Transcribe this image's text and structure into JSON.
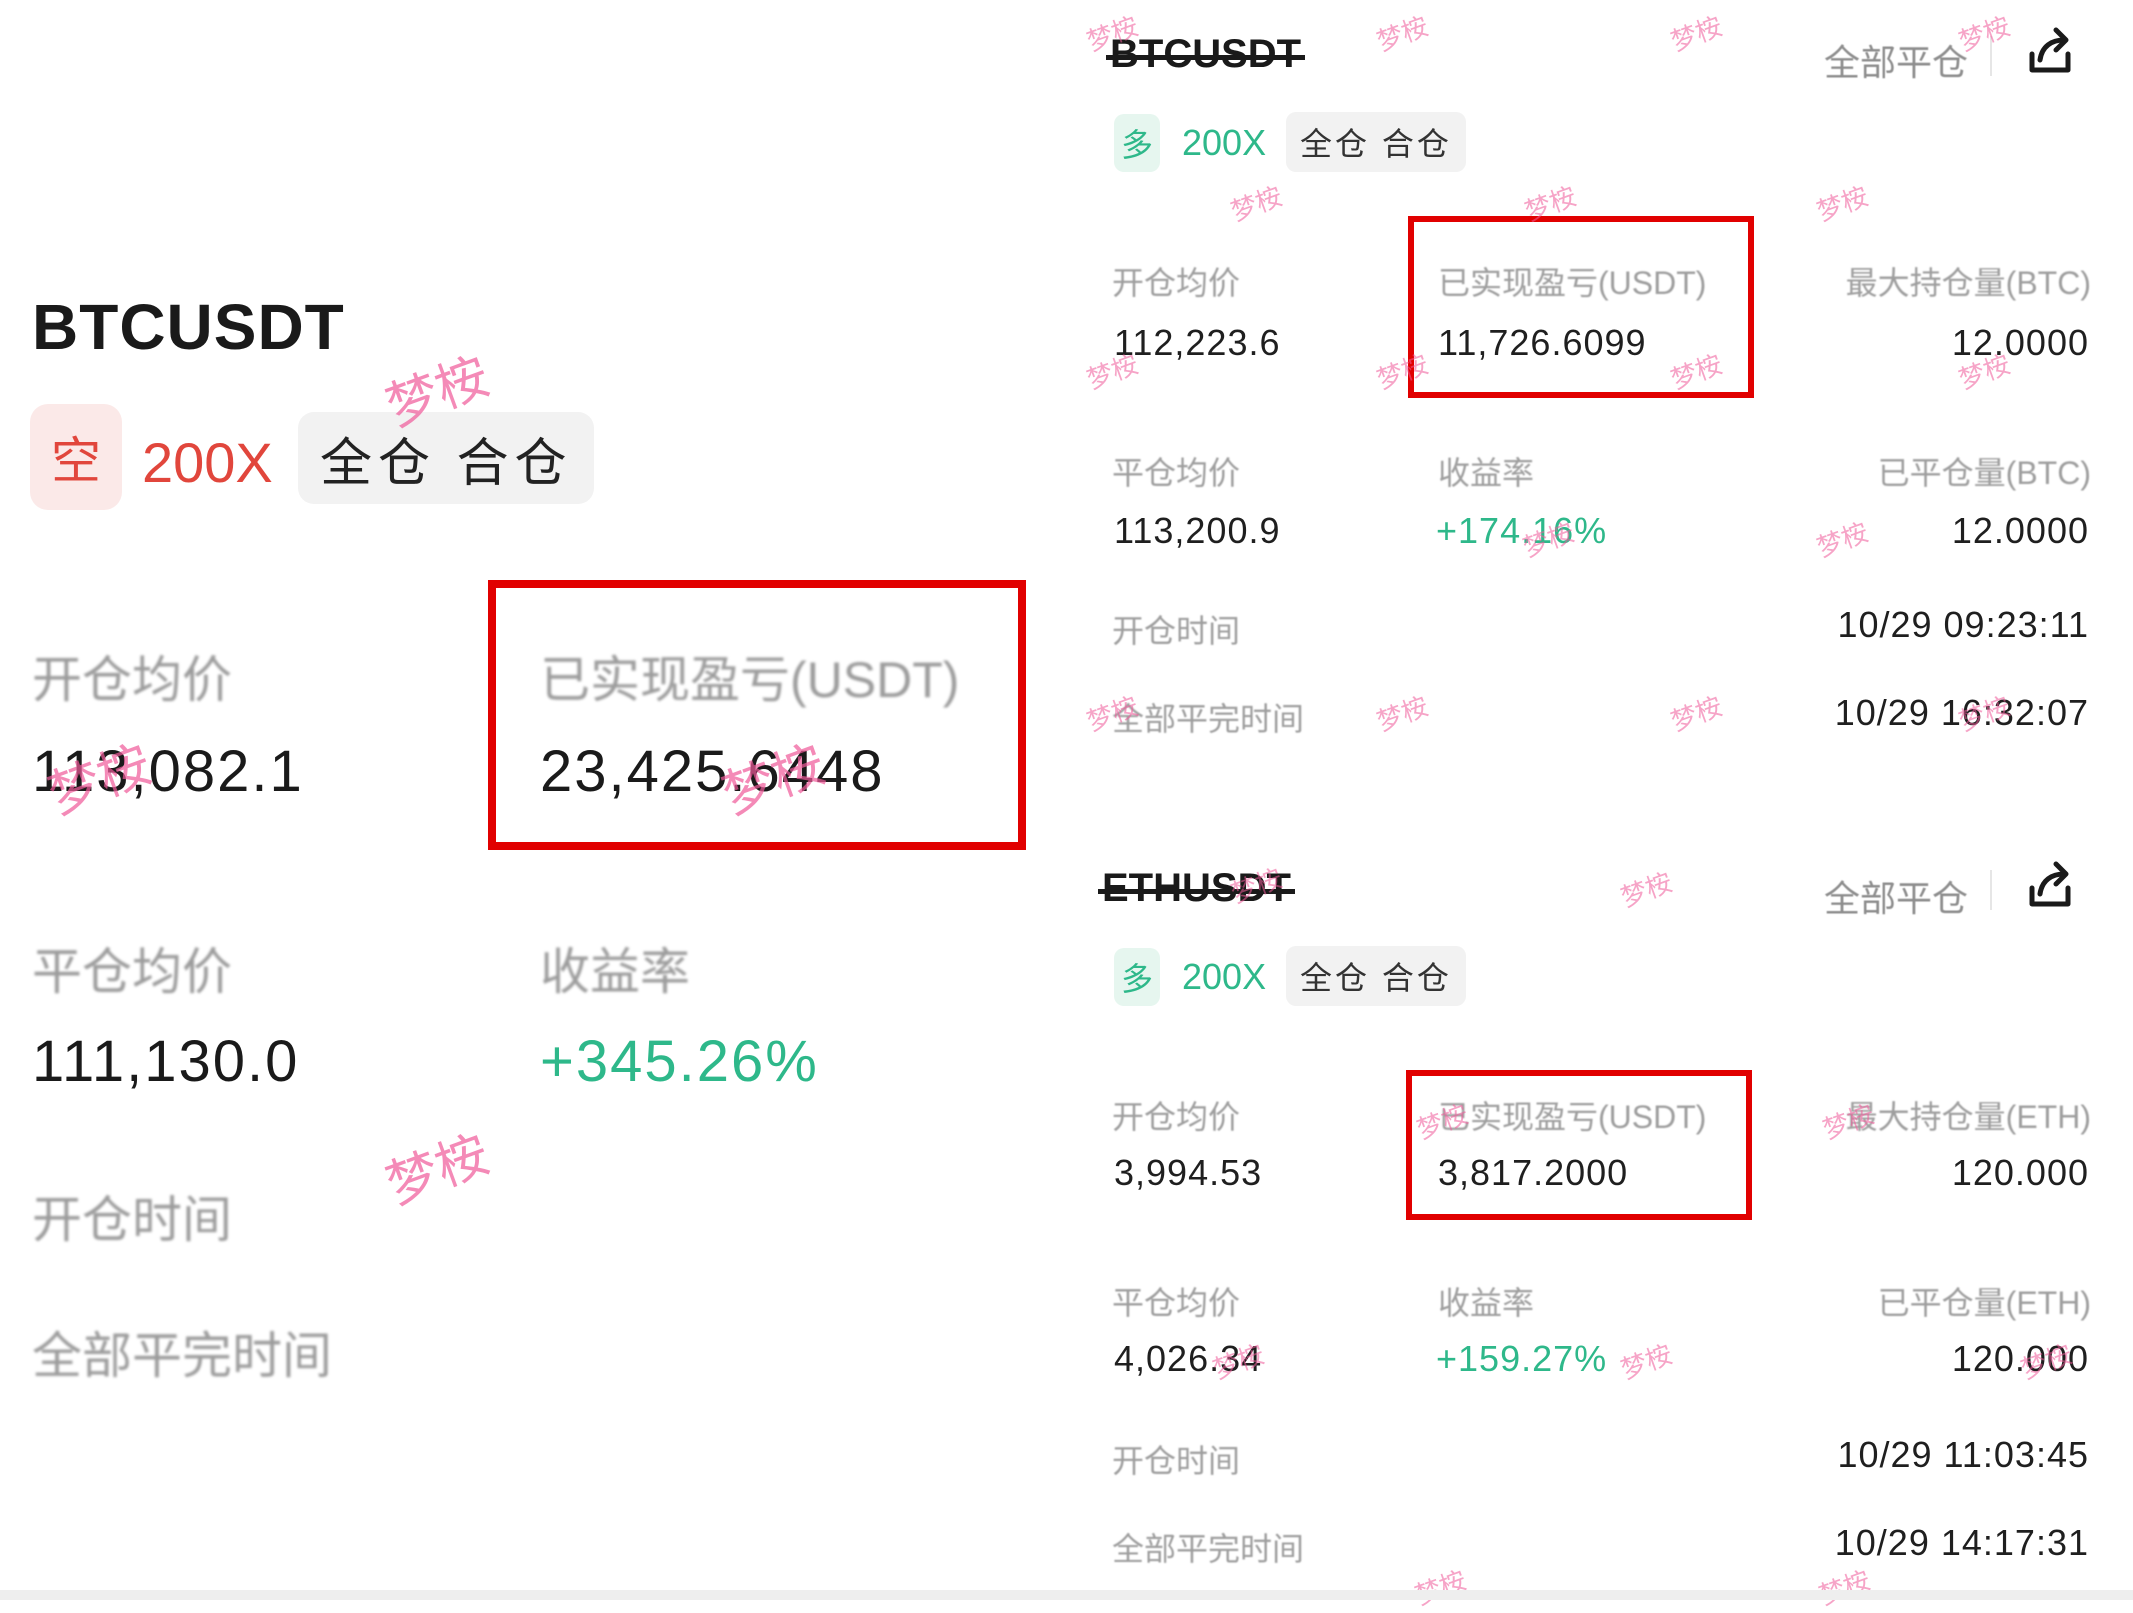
{
  "left": {
    "symbol": "BTCUSDT",
    "side": "空",
    "leverage": "200X",
    "mode": "全仓 合仓",
    "open_avg_label": "开仓均价",
    "open_avg": "113,082.1",
    "realized_label": "已实现盈亏(USDT)",
    "realized": "23,425.6448",
    "close_avg_label": "平仓均价",
    "close_avg": "111,130.0",
    "roi_label": "收益率",
    "roi": "+345.26%",
    "open_time_label": "开仓时间",
    "close_time_label": "全部平完时间"
  },
  "right": [
    {
      "symbol": "BTCUSDT",
      "close_all": "全部平仓",
      "side": "多",
      "leverage": "200X",
      "mode": "全仓 合仓",
      "open_avg_label": "开仓均价",
      "open_avg": "112,223.6",
      "realized_label": "已实现盈亏(USDT)",
      "realized": "11,726.6099",
      "max_pos_label": "最大持仓量(BTC)",
      "max_pos": "12.0000",
      "close_avg_label": "平仓均价",
      "close_avg": "113,200.9",
      "roi_label": "收益率",
      "roi": "+174.16%",
      "closed_qty_label": "已平仓量(BTC)",
      "closed_qty": "12.0000",
      "open_time_label": "开仓时间",
      "open_time": "10/29 09:23:11",
      "close_time_label": "全部平完时间",
      "close_time": "10/29 16:32:07"
    },
    {
      "symbol": "ETHUSDT",
      "close_all": "全部平仓",
      "side": "多",
      "leverage": "200X",
      "mode": "全仓 合仓",
      "open_avg_label": "开仓均价",
      "open_avg": "3,994.53",
      "realized_label": "已实现盈亏(USDT)",
      "realized": "3,817.2000",
      "max_pos_label": "最大持仓量(ETH)",
      "max_pos": "120.000",
      "close_avg_label": "平仓均价",
      "close_avg": "4,026.34",
      "roi_label": "收益率",
      "roi": "+159.27%",
      "closed_qty_label": "已平仓量(ETH)",
      "closed_qty": "120.000",
      "open_time_label": "开仓时间",
      "open_time": "10/29 11:03:45",
      "close_time_label": "全部平完时间",
      "close_time": "10/29 14:17:31"
    }
  ],
  "watermark": "梦桉",
  "icons": {
    "share": "share-icon"
  },
  "colors": {
    "red": "#e1463c",
    "green": "#2eb88a",
    "highlight": "#e10000",
    "watermark": "#f05a9a"
  }
}
